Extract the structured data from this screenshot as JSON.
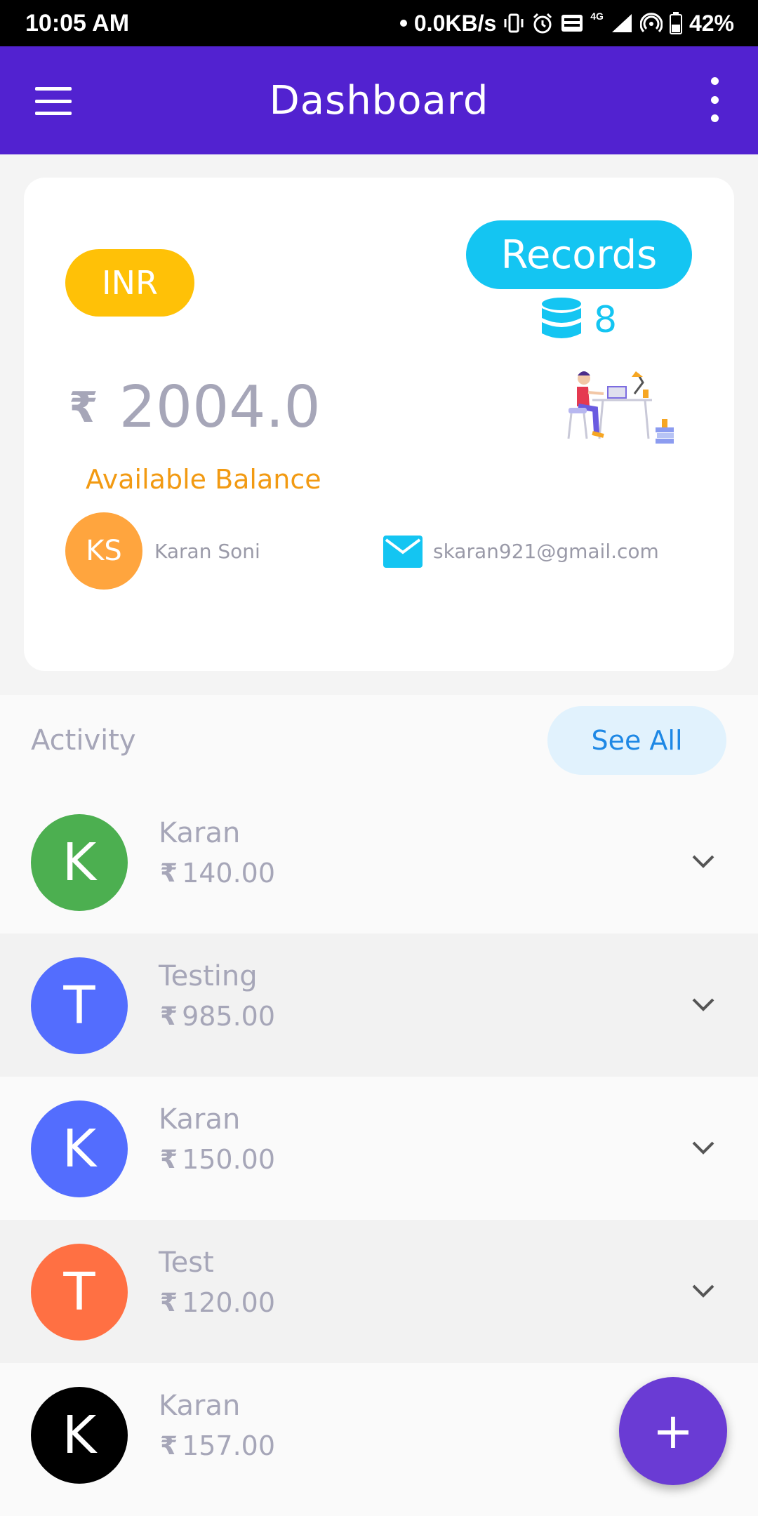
{
  "status_bar": {
    "time": "10:05 AM",
    "net_speed": "0.0KB/s",
    "network": "4G",
    "battery": "42%"
  },
  "app_bar": {
    "title": "Dashboard"
  },
  "card": {
    "currency_badge": "INR",
    "records_button": "Records",
    "records_count": "8",
    "rupee": "₹",
    "balance": "2004.0",
    "balance_label": "Available Balance",
    "avatar_initials": "KS",
    "user_name": "Karan Soni",
    "email": "skaran921@gmail.com"
  },
  "activity": {
    "title": "Activity",
    "see_all": "See All",
    "rupee": "₹",
    "items": [
      {
        "initial": "K",
        "name": "Karan",
        "amount": "140.00",
        "color": "#4caf50"
      },
      {
        "initial": "T",
        "name": "Testing",
        "amount": "985.00",
        "color": "#536dfe"
      },
      {
        "initial": "K",
        "name": "Karan",
        "amount": "150.00",
        "color": "#536dfe"
      },
      {
        "initial": "T",
        "name": "Test",
        "amount": "120.00",
        "color": "#ff7043"
      },
      {
        "initial": "K",
        "name": "Karan",
        "amount": "157.00",
        "color": "#000000"
      }
    ]
  },
  "fab": {
    "label": "+"
  },
  "colors": {
    "app_bar": "#5222d0",
    "inr_badge": "#ffc107",
    "records": "#14c5f2",
    "balance_label": "#f29a12",
    "see_all_bg": "#e1f2fd",
    "fab": "#6a3bd4"
  }
}
